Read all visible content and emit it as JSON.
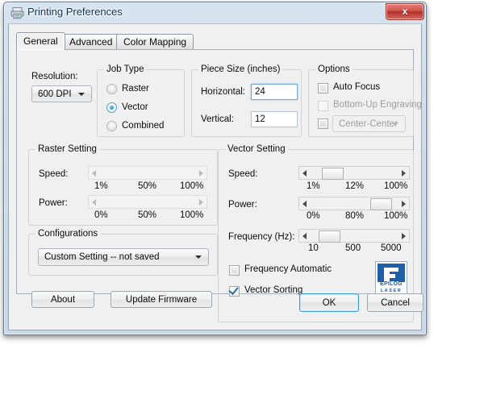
{
  "window": {
    "title": "Printing Preferences",
    "icon": "printer-icon",
    "close_label": "x"
  },
  "tabs": [
    {
      "label": "General",
      "active": true
    },
    {
      "label": "Advanced",
      "active": false
    },
    {
      "label": "Color Mapping",
      "active": false
    }
  ],
  "resolution": {
    "label": "Resolution:",
    "value": "600 DPI"
  },
  "job_type": {
    "title": "Job Type",
    "options": [
      {
        "label": "Raster",
        "selected": false
      },
      {
        "label": "Vector",
        "selected": true
      },
      {
        "label": "Combined",
        "selected": false
      }
    ]
  },
  "piece_size": {
    "title": "Piece Size (inches)",
    "horizontal_label": "Horizontal:",
    "horizontal_value": "24",
    "vertical_label": "Vertical:",
    "vertical_value": "12"
  },
  "options": {
    "title": "Options",
    "auto_focus_label": "Auto Focus",
    "auto_focus_checked": false,
    "bottom_up_label": "Bottom-Up Engraving",
    "bottom_up_checked": false,
    "center_checkbox_checked": false,
    "center_value": "Center-Center"
  },
  "raster_setting": {
    "title": "Raster Setting",
    "speed_label": "Speed:",
    "speed_ticks": [
      "1%",
      "50%",
      "100%"
    ],
    "power_label": "Power:",
    "power_ticks": [
      "0%",
      "50%",
      "100%"
    ]
  },
  "vector_setting": {
    "title": "Vector Setting",
    "speed_label": "Speed:",
    "speed_ticks": [
      "1%",
      "12%",
      "100%"
    ],
    "speed_value": "12%",
    "power_label": "Power:",
    "power_ticks": [
      "0%",
      "80%",
      "100%"
    ],
    "power_value": "80%",
    "frequency_label": "Frequency (Hz):",
    "frequency_ticks": [
      "10",
      "500",
      "5000"
    ],
    "frequency_value": "500",
    "frequency_automatic_label": "Frequency Automatic",
    "frequency_automatic_checked": false,
    "vector_sorting_label": "Vector Sorting",
    "vector_sorting_checked": true
  },
  "configurations": {
    "title": "Configurations",
    "value": "Custom Setting -- not saved"
  },
  "buttons": {
    "about": "About",
    "update_firmware": "Update Firmware",
    "ok": "OK",
    "cancel": "Cancel"
  },
  "logo": {
    "letter": "E",
    "line1": "EPILOG",
    "line2": "LASER",
    "color": "#1f5fa8"
  }
}
